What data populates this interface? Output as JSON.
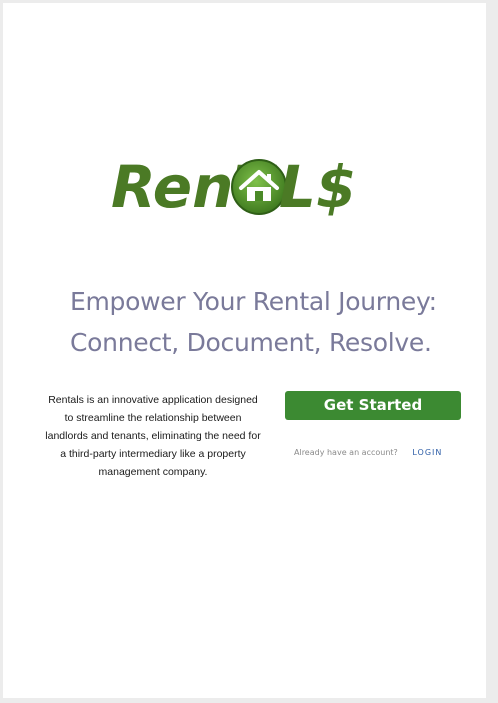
{
  "logo": {
    "text_left": "RenT",
    "text_right": "L$",
    "icon": "house-icon",
    "brand_color": "#4b7a25"
  },
  "hero": {
    "headline_line1": "Empower Your Rental Journey:",
    "headline_line2": "Connect, Document, Resolve.",
    "description": "Rentals is an innovative application designed to streamline the relationship between landlords and tenants, eliminating the need for a third-party intermediary like a property management company."
  },
  "actions": {
    "get_started_label": "Get Started",
    "already_text": "Already have an account?",
    "login_label": "LOGIN",
    "button_color": "#3c8a32",
    "link_color": "#2f5fa8"
  }
}
